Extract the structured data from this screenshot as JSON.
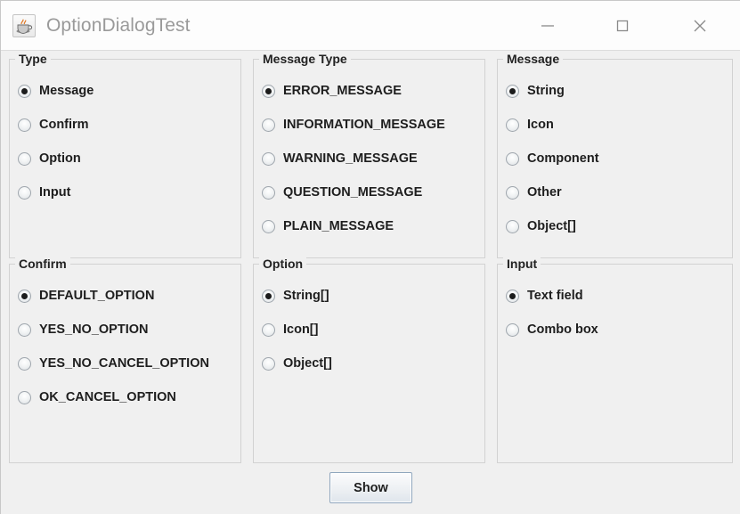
{
  "window": {
    "title": "OptionDialogTest",
    "icon": "java-coffee-cup-icon",
    "background_color": "#f0f0f0",
    "titlebar_color": "#fdfdfd",
    "controls": {
      "minimize": "minimize-icon",
      "maximize": "maximize-icon",
      "close": "close-icon"
    }
  },
  "panels": [
    {
      "id": "type",
      "title": "Type",
      "options": [
        {
          "label": "Message",
          "checked": true
        },
        {
          "label": "Confirm",
          "checked": false
        },
        {
          "label": "Option",
          "checked": false
        },
        {
          "label": "Input",
          "checked": false
        }
      ]
    },
    {
      "id": "message-type",
      "title": "Message Type",
      "options": [
        {
          "label": "ERROR_MESSAGE",
          "checked": true
        },
        {
          "label": "INFORMATION_MESSAGE",
          "checked": false
        },
        {
          "label": "WARNING_MESSAGE",
          "checked": false
        },
        {
          "label": "QUESTION_MESSAGE",
          "checked": false
        },
        {
          "label": "PLAIN_MESSAGE",
          "checked": false
        }
      ]
    },
    {
      "id": "message",
      "title": "Message",
      "options": [
        {
          "label": "String",
          "checked": true
        },
        {
          "label": "Icon",
          "checked": false
        },
        {
          "label": "Component",
          "checked": false
        },
        {
          "label": "Other",
          "checked": false
        },
        {
          "label": "Object[]",
          "checked": false
        }
      ]
    },
    {
      "id": "confirm",
      "title": "Confirm",
      "options": [
        {
          "label": "DEFAULT_OPTION",
          "checked": true
        },
        {
          "label": "YES_NO_OPTION",
          "checked": false
        },
        {
          "label": "YES_NO_CANCEL_OPTION",
          "checked": false
        },
        {
          "label": "OK_CANCEL_OPTION",
          "checked": false
        }
      ]
    },
    {
      "id": "option",
      "title": "Option",
      "options": [
        {
          "label": "String[]",
          "checked": true
        },
        {
          "label": "Icon[]",
          "checked": false
        },
        {
          "label": "Object[]",
          "checked": false
        }
      ]
    },
    {
      "id": "input",
      "title": "Input",
      "options": [
        {
          "label": "Text field",
          "checked": true
        },
        {
          "label": "Combo box",
          "checked": false
        }
      ]
    }
  ],
  "actions": {
    "show_button_label": "Show"
  }
}
